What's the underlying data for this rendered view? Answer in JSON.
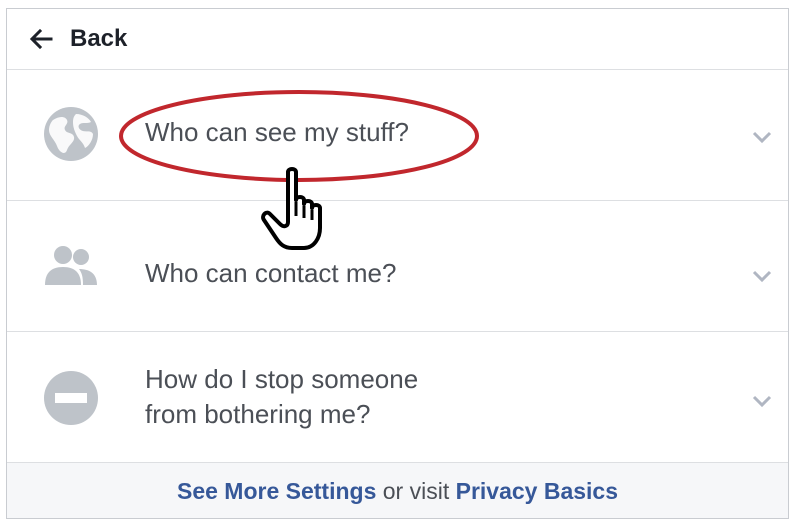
{
  "header": {
    "back_label": "Back",
    "back_icon": "left-arrow-icon"
  },
  "rows": [
    {
      "label": "Who can see my stuff?",
      "icon": "globe-icon"
    },
    {
      "label": "Who can contact me?",
      "icon": "people-icon"
    },
    {
      "label_line1": "How do I stop someone",
      "label_line2": "from bothering me?",
      "icon": "block-icon"
    }
  ],
  "footer": {
    "link1": "See More Settings",
    "middle": " or visit ",
    "link2": "Privacy Basics"
  },
  "colors": {
    "link": "#365899",
    "text": "#4b4f56",
    "icon_gray": "#bec3c9",
    "highlight": "#c1272d"
  }
}
